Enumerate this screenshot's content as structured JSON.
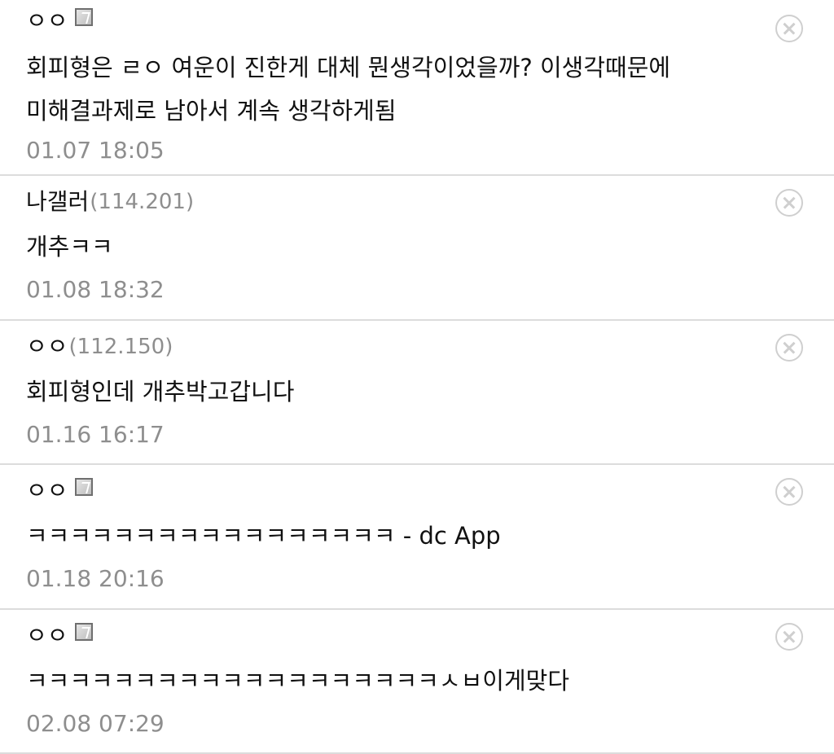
{
  "comments": [
    {
      "nickname": "ㅇㅇ",
      "ip": "",
      "badge": "fixed-nick-badge-icon",
      "text": "회피형은 ㄹㅇ 여운이 진한게 대체 뭔생각이었을까? 이생각때문에 미해결과제로 남아서 계속 생각하게됨",
      "time": "01.07 18:05",
      "delete_icon": "close-circle-icon"
    },
    {
      "nickname": "나갤러",
      "ip": "(114.201)",
      "text": "개추ㅋㅋ",
      "time": "01.08 18:32",
      "delete_icon": "close-circle-icon"
    },
    {
      "nickname": "ㅇㅇ",
      "ip": "(112.150)",
      "text": "회피형인데 개추박고갑니다",
      "time": "01.16 16:17",
      "delete_icon": "close-circle-icon"
    },
    {
      "nickname": "ㅇㅇ",
      "ip": "",
      "badge": "fixed-nick-badge-icon",
      "text": "ㅋㅋㅋㅋㅋㅋㅋㅋㅋㅋㅋㅋㅋㅋㅋㅋㅋ - dc App",
      "time": "01.18 20:16",
      "delete_icon": "close-circle-icon"
    },
    {
      "nickname": "ㅇㅇ",
      "ip": "",
      "badge": "fixed-nick-badge-icon",
      "text": "ㅋㅋㅋㅋㅋㅋㅋㅋㅋㅋㅋㅋㅋㅋㅋㅋㅋㅋㅋㅅㅂ이게맞다",
      "time": "02.08 07:29",
      "delete_icon": "close-circle-icon"
    }
  ],
  "colors": {
    "text": "#111111",
    "meta": "#8e8e8e",
    "divider": "#dcdcdc",
    "delete": "#cfcfcf"
  }
}
